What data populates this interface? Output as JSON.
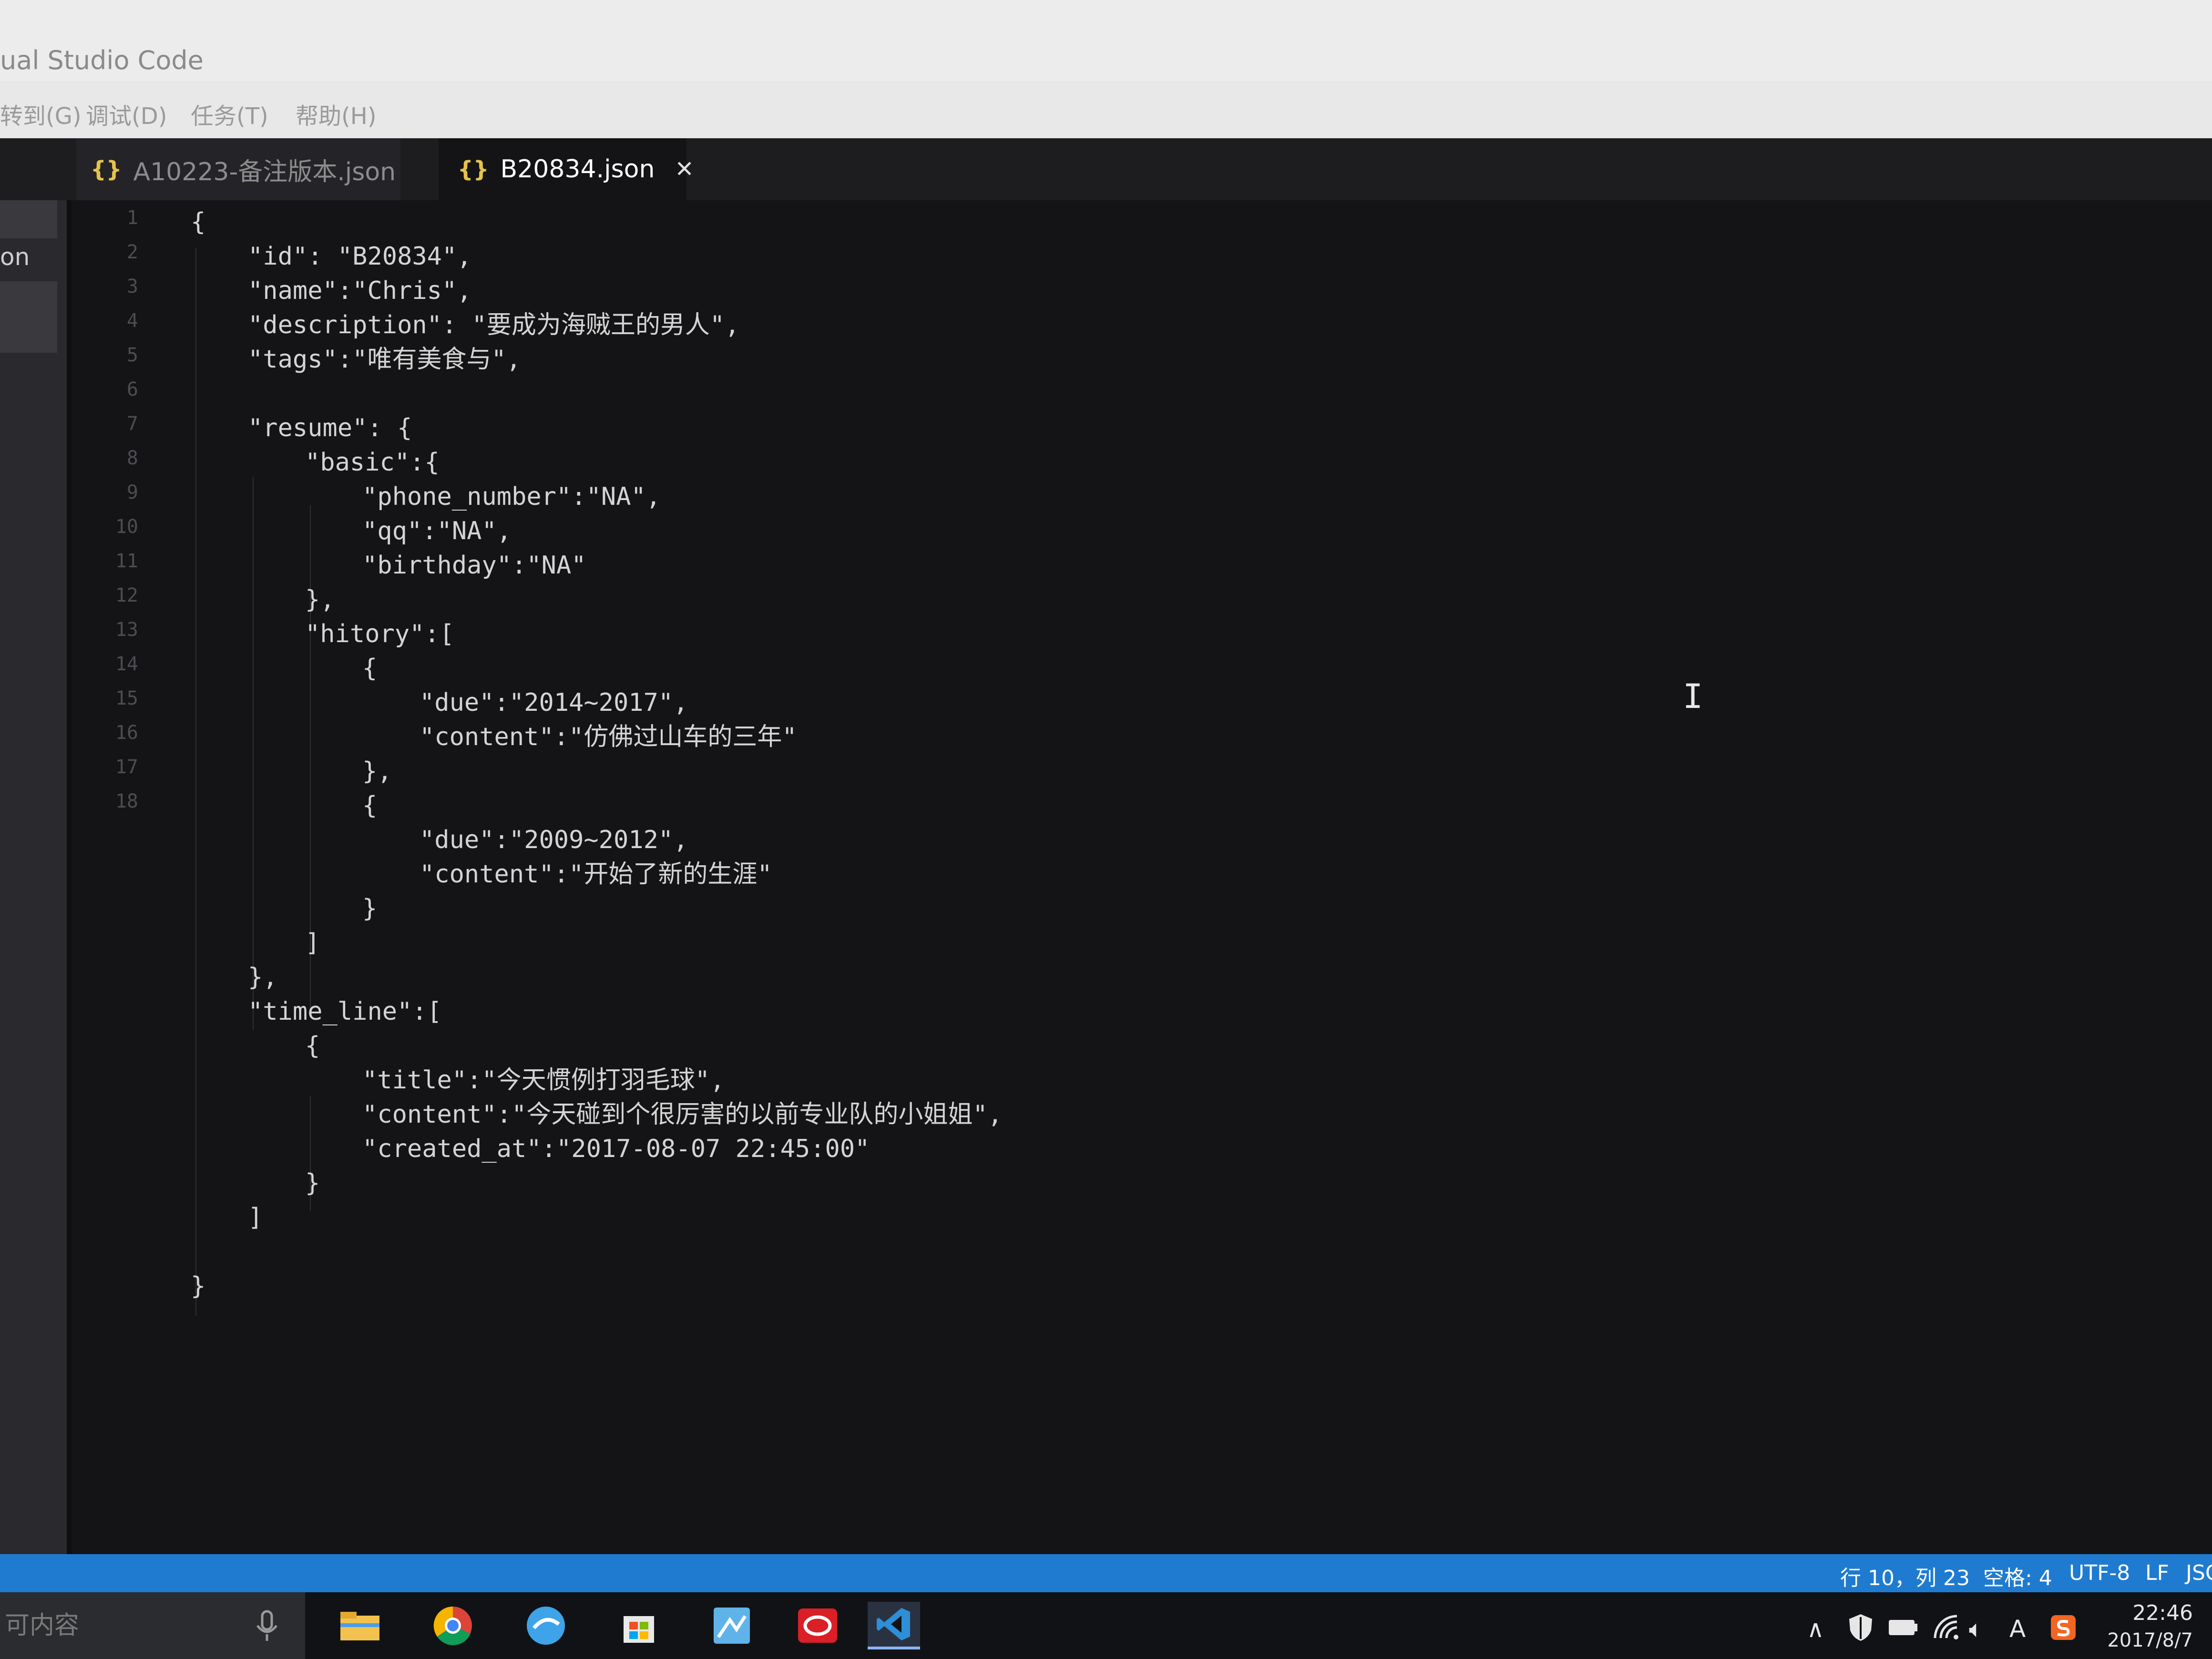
{
  "window": {
    "title": "ual Studio Code"
  },
  "menu": {
    "items": [
      "转到(G)",
      "调试(D)",
      "任务(T)",
      "帮助(H)"
    ]
  },
  "tabs": [
    {
      "label": "A10223-备注版本.json",
      "active": false
    },
    {
      "label": "B20834.json",
      "active": true
    }
  ],
  "sidebar": {
    "label": "on"
  },
  "editor": {
    "line_numbers": [
      "1",
      "2",
      "3",
      "4",
      "5",
      "6",
      "7",
      "8",
      "9",
      "10",
      "11",
      "12",
      "13",
      "14",
      "15",
      "16",
      "17",
      "18"
    ],
    "lines": [
      {
        "indent": 0,
        "text": "{"
      },
      {
        "indent": 1,
        "text": "\"id\": \"B20834\","
      },
      {
        "indent": 1,
        "text": "\"name\":\"Chris\","
      },
      {
        "indent": 1,
        "text": "\"description\": \"要成为海贼王的男人\","
      },
      {
        "indent": 1,
        "text": "\"tags\":\"唯有美食与\","
      },
      {
        "indent": 0,
        "text": ""
      },
      {
        "indent": 1,
        "text": "\"resume\": {"
      },
      {
        "indent": 2,
        "text": "\"basic\":{"
      },
      {
        "indent": 3,
        "text": "\"phone_number\":\"NA\","
      },
      {
        "indent": 3,
        "text": "\"qq\":\"NA\","
      },
      {
        "indent": 3,
        "text": "\"birthday\":\"NA\""
      },
      {
        "indent": 2,
        "text": "},"
      },
      {
        "indent": 2,
        "text": "\"hitory\":["
      },
      {
        "indent": 3,
        "text": "{"
      },
      {
        "indent": 4,
        "text": "\"due\":\"2014~2017\","
      },
      {
        "indent": 4,
        "text": "\"content\":\"仿佛过山车的三年\""
      },
      {
        "indent": 3,
        "text": "},"
      },
      {
        "indent": 3,
        "text": "{"
      },
      {
        "indent": 4,
        "text": "\"due\":\"2009~2012\","
      },
      {
        "indent": 4,
        "text": "\"content\":\"开始了新的生涯\""
      },
      {
        "indent": 3,
        "text": "}"
      },
      {
        "indent": 2,
        "text": "]"
      },
      {
        "indent": 1,
        "text": "},"
      },
      {
        "indent": 1,
        "text": "\"time_line\":["
      },
      {
        "indent": 2,
        "text": "{"
      },
      {
        "indent": 3,
        "text": "\"title\":\"今天惯例打羽毛球\","
      },
      {
        "indent": 3,
        "text": "\"content\":\"今天碰到个很厉害的以前专业队的小姐姐\","
      },
      {
        "indent": 3,
        "text": "\"created_at\":\"2017-08-07 22:45:00\""
      },
      {
        "indent": 2,
        "text": "}"
      },
      {
        "indent": 1,
        "text": "]"
      },
      {
        "indent": 0,
        "text": ""
      },
      {
        "indent": 0,
        "text": "}"
      }
    ]
  },
  "statusbar": {
    "position": "行 10，列 23",
    "spaces": "空格: 4",
    "encoding": "UTF-8",
    "eol": "LF",
    "language": "JSO"
  },
  "taskbar": {
    "search_placeholder": "可内容",
    "apps": [
      "mic-icon",
      "file-explorer-icon",
      "chrome-icon",
      "qq-browser-icon",
      "store-icon",
      "image-app-icon",
      "creative-cloud-icon",
      "vscode-icon"
    ],
    "tray": {
      "ime_label": "A",
      "time": "22:46",
      "date": "2017/8/7"
    }
  },
  "colors": {
    "editor_bg": "#141416",
    "statusbar_bg": "#1f7bd0",
    "json_icon": "#e6c24a"
  }
}
